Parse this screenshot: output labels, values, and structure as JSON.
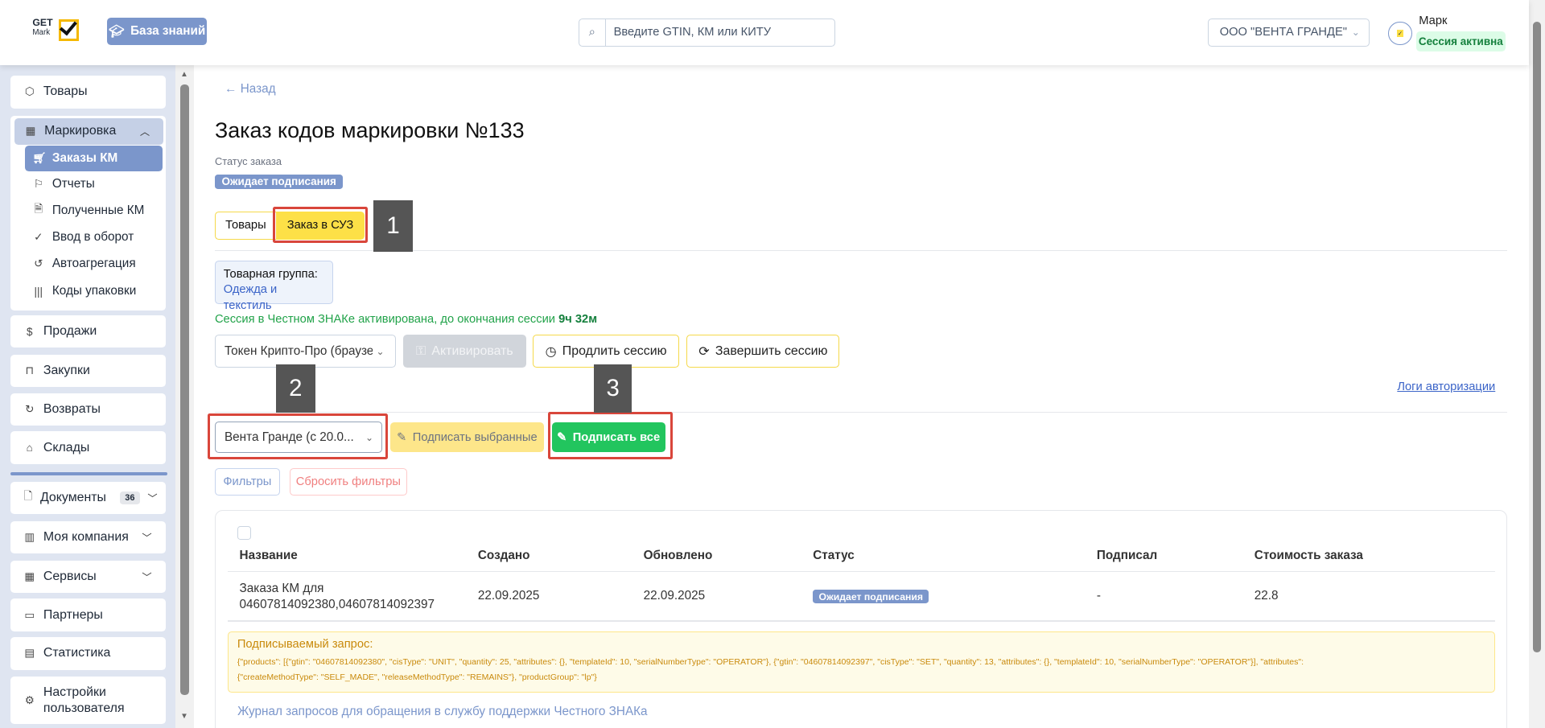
{
  "header": {
    "logo_top": "GET",
    "logo_bottom": "Mark",
    "kb_button": "База знаний",
    "search_placeholder": "Введите GTIN, КМ или КИТУ",
    "company": "ООО \"ВЕНТА ГРАНДЕ\"",
    "user_name": "Марк",
    "session_badge": "Сессия активна"
  },
  "sidebar": {
    "items": [
      {
        "label": "Товары",
        "icon": "box-icon"
      },
      {
        "label": "Маркировка",
        "icon": "qr-icon"
      },
      {
        "label": "Продажи",
        "icon": "dollar-icon"
      },
      {
        "label": "Закупки",
        "icon": "bag-icon"
      },
      {
        "label": "Возвраты",
        "icon": "return-icon"
      },
      {
        "label": "Склады",
        "icon": "warehouse-icon"
      },
      {
        "label": "Документы",
        "icon": "document-icon",
        "badge": "36"
      },
      {
        "label": "Моя компания",
        "icon": "building-icon"
      },
      {
        "label": "Сервисы",
        "icon": "grid-icon"
      },
      {
        "label": "Партнеры",
        "icon": "partners-icon"
      },
      {
        "label": "Статистика",
        "icon": "chart-icon"
      },
      {
        "label": "Настройки пользователя",
        "icon": "gear-icon"
      }
    ],
    "sub_items": [
      {
        "label": "Заказы КМ",
        "icon": "cart-icon",
        "active": true
      },
      {
        "label": "Отчеты",
        "icon": "flag-icon"
      },
      {
        "label": "Полученные КМ",
        "icon": "file-check-icon"
      },
      {
        "label": "Ввод в оборот",
        "icon": "check-circle-icon"
      },
      {
        "label": "Автоагрегация",
        "icon": "history-icon"
      },
      {
        "label": "Коды упаковки",
        "icon": "barcode-icon"
      }
    ]
  },
  "main": {
    "back": "Назад",
    "title": "Заказ кодов маркировки №133",
    "status_label": "Статус заказа",
    "status": "Ожидает подписания",
    "tabs": [
      {
        "label": "Товары",
        "active": false
      },
      {
        "label": "Заказ в СУЗ",
        "active": true
      }
    ],
    "product_group_label": "Товарная группа:",
    "product_group": "Одежда и текстиль",
    "session_text": "Сессия в Честном ЗНАКе активирована, до окончания сессии ",
    "session_time": "9ч 32м",
    "token_select": "Токен Крипто-Про (браузер)",
    "activate": "Активировать",
    "extend": "Продлить сессию",
    "finish": "Завершить сессию",
    "auth_logs": "Логи авторизации",
    "signer_select": "Вента Гранде (с 20.0...",
    "sign_selected": "Подписать выбранные",
    "sign_all": "Подписать все",
    "filters": "Фильтры",
    "reset_filters": "Сбросить фильтры",
    "annotations": [
      "1",
      "2",
      "3"
    ],
    "table": {
      "columns": [
        "Название",
        "Создано",
        "Обновлено",
        "Статус",
        "Подписал",
        "Стоимость заказа"
      ],
      "rows": [
        {
          "name_line1": "Заказа КМ для",
          "name_line2": "04607814092380,04607814092397",
          "created": "22.09.2025",
          "updated": "22.09.2025",
          "status": "Ожидает подписания",
          "signed_by": "-",
          "cost": "22.8"
        }
      ]
    },
    "request_label": "Подписываемый запрос:",
    "request_line1": "{\"products\": [{\"gtin\": \"04607814092380\", \"cisType\": \"UNIT\", \"quantity\": 25, \"attributes\": {}, \"templateId\": 10, \"serialNumberType\": \"OPERATOR\"}, {\"gtin\": \"04607814092397\", \"cisType\": \"SET\", \"quantity\": 13, \"attributes\": {}, \"templateId\": 10, \"serialNumberType\": \"OPERATOR\"}], \"attributes\":",
    "request_line2": "{\"createMethodType\": \"SELF_MADE\", \"releaseMethodType\": \"REMAINS\"}, \"productGroup\": \"lp\"}",
    "journal_link": "Журнал запросов для обращения в службу поддержки Честного ЗНАКа"
  },
  "colors": {
    "accent": "#7b96cb",
    "yellow": "#fde047",
    "green": "#22c55e",
    "annotation_red": "#d9463b"
  }
}
